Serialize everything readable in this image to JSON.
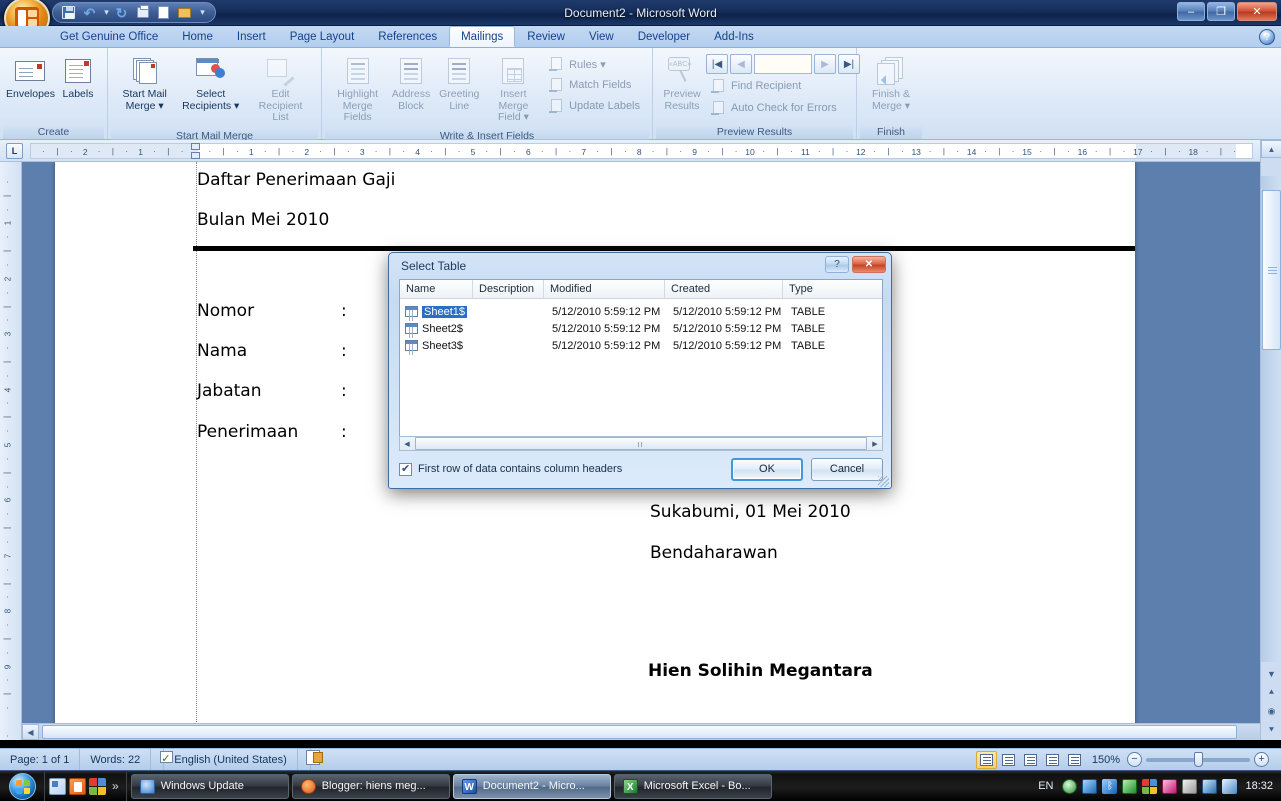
{
  "window": {
    "title": "Document2 - Microsoft Word",
    "minimize": "–",
    "maximize": "❐",
    "close": "✕",
    "help": "?"
  },
  "quick_access": {
    "save": "save-icon",
    "undo": "↶",
    "undo_drop": "▾",
    "redo": "↻",
    "print_preview": "print-preview-icon",
    "new": "new-doc-icon",
    "open": "open-folder-icon",
    "customize": "▾"
  },
  "tabs": [
    {
      "label": "Get Genuine Office",
      "active": false
    },
    {
      "label": "Home",
      "active": false
    },
    {
      "label": "Insert",
      "active": false
    },
    {
      "label": "Page Layout",
      "active": false
    },
    {
      "label": "References",
      "active": false
    },
    {
      "label": "Mailings",
      "active": true
    },
    {
      "label": "Review",
      "active": false
    },
    {
      "label": "View",
      "active": false
    },
    {
      "label": "Developer",
      "active": false
    },
    {
      "label": "Add-Ins",
      "active": false
    }
  ],
  "ribbon": {
    "groups": [
      {
        "name": "Create",
        "buttons": [
          {
            "label": "Envelopes",
            "disabled": false
          },
          {
            "label": "Labels",
            "disabled": false
          }
        ]
      },
      {
        "name": "Start Mail Merge",
        "buttons": [
          {
            "label": "Start Mail\nMerge ▾",
            "disabled": false
          },
          {
            "label": "Select\nRecipients ▾",
            "disabled": false
          },
          {
            "label": "Edit\nRecipient List",
            "disabled": true
          }
        ]
      },
      {
        "name": "Write & Insert Fields",
        "buttons": [
          {
            "label": "Highlight\nMerge Fields",
            "disabled": true
          },
          {
            "label": "Address\nBlock",
            "disabled": true
          },
          {
            "label": "Greeting\nLine",
            "disabled": true
          },
          {
            "label": "Insert Merge\nField ▾",
            "disabled": true
          }
        ],
        "side_buttons": [
          {
            "label": "Rules ▾",
            "disabled": true
          },
          {
            "label": "Match Fields",
            "disabled": true
          },
          {
            "label": "Update Labels",
            "disabled": true
          }
        ]
      },
      {
        "name": "Preview Results",
        "buttons": [
          {
            "label": "Preview\nResults",
            "disabled": true
          }
        ],
        "side_buttons": [
          {
            "label": "Find Recipient",
            "disabled": true
          },
          {
            "label": "Auto Check for Errors",
            "disabled": true
          }
        ],
        "nav": {
          "first": "|◀",
          "prev": "◀",
          "record_value": "",
          "next": "▶",
          "last": "▶|"
        }
      },
      {
        "name": "Finish",
        "buttons": [
          {
            "label": "Finish &\nMerge ▾",
            "disabled": true
          }
        ]
      }
    ]
  },
  "ruler": {
    "tab_selector": "L",
    "h_labels_left": [
      "2",
      "1"
    ],
    "h_labels_right": [
      "1",
      "2",
      "3",
      "4",
      "5",
      "6",
      "7",
      "8",
      "9",
      "10",
      "11",
      "12",
      "13",
      "14",
      "15",
      "16",
      "17",
      "18"
    ],
    "v_labels": [
      "1",
      "2",
      "3",
      "4",
      "5",
      "6",
      "7",
      "8",
      "9"
    ]
  },
  "document": {
    "heading1": "Daftar Penerimaan Gaji",
    "heading2": "Bulan Mei 2010",
    "fields": [
      {
        "label": "Nomor",
        "colon": ":"
      },
      {
        "label": "Nama",
        "colon": ":"
      },
      {
        "label": "Jabatan",
        "colon": ":"
      },
      {
        "label": "Penerimaan",
        "colon": ":"
      }
    ],
    "place_date": "Sukabumi, 01 Mei 2010",
    "role": "Bendaharawan",
    "signer": "Hien Solihin Megantara"
  },
  "dialog": {
    "title": "Select Table",
    "help_label": "?",
    "close_label": "✕",
    "columns": [
      "Name",
      "Description",
      "Modified",
      "Created",
      "Type"
    ],
    "rows": [
      {
        "name": "Sheet1$",
        "description": "",
        "modified": "5/12/2010 5:59:12 PM",
        "created": "5/12/2010 5:59:12 PM",
        "type": "TABLE",
        "selected": true
      },
      {
        "name": "Sheet2$",
        "description": "",
        "modified": "5/12/2010 5:59:12 PM",
        "created": "5/12/2010 5:59:12 PM",
        "type": "TABLE",
        "selected": false
      },
      {
        "name": "Sheet3$",
        "description": "",
        "modified": "5/12/2010 5:59:12 PM",
        "created": "5/12/2010 5:59:12 PM",
        "type": "TABLE",
        "selected": false
      }
    ],
    "checkbox_label": "First row of data contains column headers",
    "checkbox_checked": true,
    "ok_label": "OK",
    "cancel_label": "Cancel"
  },
  "status_bar": {
    "page": "Page: 1 of 1",
    "words": "Words: 22",
    "language": "English (United States)",
    "zoom": "150%",
    "zoom_out": "−",
    "zoom_in": "+"
  },
  "taskbar": {
    "start": "start-orb",
    "quick_launch_more": "»",
    "tasks": [
      {
        "label": "Windows Update",
        "active": false
      },
      {
        "label": "Blogger: hiens meg...",
        "active": false
      },
      {
        "label": "Document2 - Micro...",
        "active": true
      },
      {
        "label": "Microsoft Excel - Bo...",
        "active": false
      }
    ],
    "language": "EN",
    "clock": "18:32"
  }
}
